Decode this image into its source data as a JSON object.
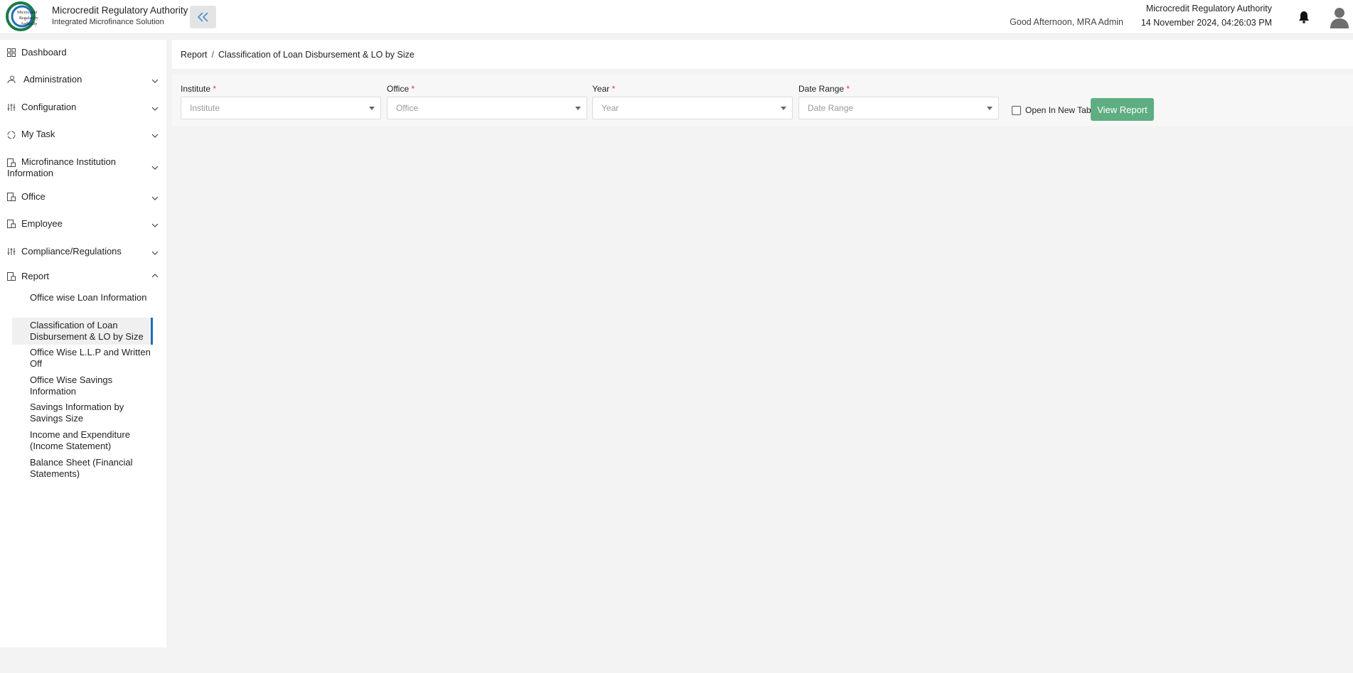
{
  "header": {
    "logo_text": "Microcredit Regulatory Authority",
    "brand_title": "Microcredit Regulatory Authority",
    "brand_subtitle": "Integrated Microfinance Solution",
    "greeting": "Good Afternoon, MRA Admin",
    "org_name": "Microcredit Regulatory Authority",
    "datetime": "14 November 2024, 04:26:03 PM"
  },
  "sidebar": {
    "items": [
      {
        "label": "Dashboard",
        "icon": "grid-icon"
      },
      {
        "label": "Administration",
        "icon": "users-icon"
      },
      {
        "label": "Configuration",
        "icon": "sliders-icon"
      },
      {
        "label": "My Task",
        "icon": "circle-icon"
      },
      {
        "label": "Microfinance Institution Information",
        "icon": "doc-icon"
      },
      {
        "label": "Office",
        "icon": "doc-icon"
      },
      {
        "label": "Employee",
        "icon": "doc-icon"
      },
      {
        "label": "Compliance/Regulations",
        "icon": "sliders-icon"
      },
      {
        "label": "Report",
        "icon": "doc-icon"
      }
    ],
    "report_subitems": [
      "Office wise Loan Information",
      "Classification of Loan Disbursement & LO by Size",
      "Office Wise L.L.P and Written Off",
      "Office Wise Savings Information",
      "Savings Information by Savings Size",
      "Income and Expenditure (Income Statement)",
      "Balance Sheet (Financial Statements)"
    ]
  },
  "breadcrumb": {
    "root": "Report",
    "separator": "/",
    "current": "Classification of Loan Disbursement & LO by Size"
  },
  "filters": {
    "institute": {
      "label": "Institute",
      "placeholder": "Institute"
    },
    "office": {
      "label": "Office",
      "placeholder": "Office"
    },
    "year": {
      "label": "Year",
      "placeholder": "Year"
    },
    "date_range": {
      "label": "Date Range",
      "placeholder": "Date Range"
    },
    "required_mark": "*",
    "open_new_tab": "Open In New Tab",
    "view_report": "View Report"
  },
  "colors": {
    "accent": "#1e6fb8",
    "button": "#5fae82",
    "required": "#e23c3c"
  }
}
